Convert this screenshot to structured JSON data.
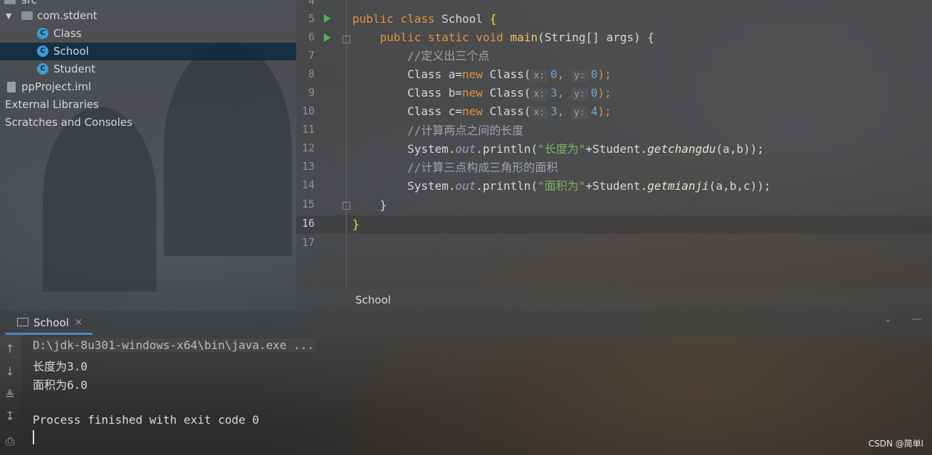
{
  "project_tree": {
    "items": [
      {
        "label": "src",
        "icon": "folder-icon"
      },
      {
        "label": "com.stdent",
        "icon": "package-folder-icon"
      },
      {
        "label": "Class",
        "icon": "java-class-icon"
      },
      {
        "label": "School",
        "icon": "java-class-icon",
        "selected": true
      },
      {
        "label": "Student",
        "icon": "java-class-icon"
      },
      {
        "label": "ppProject.iml",
        "icon": "iml-file-icon"
      },
      {
        "label": "External Libraries",
        "icon": "libraries-icon"
      },
      {
        "label": "Scratches and Consoles",
        "icon": "scratches-icon"
      }
    ]
  },
  "editor": {
    "line_numbers": [
      "4",
      "5",
      "6",
      "7",
      "8",
      "9",
      "10",
      "11",
      "12",
      "13",
      "14",
      "15",
      "16",
      "17"
    ],
    "current_line": "16",
    "code": {
      "l5_public": "public",
      "l5_class": "class",
      "l5_name": "School",
      "l5_brace": "{",
      "l6_public": "public",
      "l6_static": "static",
      "l6_void": "void",
      "l6_main": "main",
      "l6_rest": "(String[] args) {",
      "l7_comment": "//定义出三个点",
      "l8_decl": "Class a=",
      "l8_new": "new",
      "l8_ctor": "Class(",
      "l8_hint_x": "x:",
      "l8_x": "0",
      "l8_hint_y": "y:",
      "l8_y": "0",
      "l8_end": ");",
      "l9_decl": "Class b=",
      "l9_new": "new",
      "l9_ctor": "Class(",
      "l9_hint_x": "x:",
      "l9_x": "3",
      "l9_hint_y": "y:",
      "l9_y": "0",
      "l9_end": ");",
      "l10_decl": "Class c=",
      "l10_new": "new",
      "l10_ctor": "Class(",
      "l10_hint_x": "x:",
      "l10_x": "3",
      "l10_hint_y": "y:",
      "l10_y": "4",
      "l10_end": ");",
      "l11_comment": "//计算两点之间的长度",
      "l12_sys": "System.",
      "l12_out": "out",
      "l12_println": ".println(",
      "l12_str": "\"长度为\"",
      "l12_plus": "+Student.",
      "l12_method": "getchangdu",
      "l12_args": "(a,b));",
      "l13_comment": "//计算三点构成三角形的面积",
      "l14_sys": "System.",
      "l14_out": "out",
      "l14_println": ".println(",
      "l14_str": "\"面积为\"",
      "l14_plus": "+Student.",
      "l14_method": "getmianji",
      "l14_args": "(a,b,c));",
      "l15_brace": "}",
      "l16_brace": "}"
    },
    "breadcrumb": "School"
  },
  "run_panel": {
    "tab_label": "School",
    "tab_close": "×",
    "console": {
      "cmd": "D:\\jdk-8u301-windows-x64\\bin\\java.exe ...",
      "out1": "长度为3.0",
      "out2": "面积为6.0",
      "finish": "Process finished with exit code 0"
    }
  },
  "watermark": "CSDN @简单l",
  "colors": {
    "keyword": "#e3913c",
    "method": "#f2c15f",
    "string": "#7fb35d",
    "number": "#6aa8d8",
    "static_field": "#b78dd1",
    "selection": "#0d293e",
    "run_green": "#4fb84f"
  }
}
